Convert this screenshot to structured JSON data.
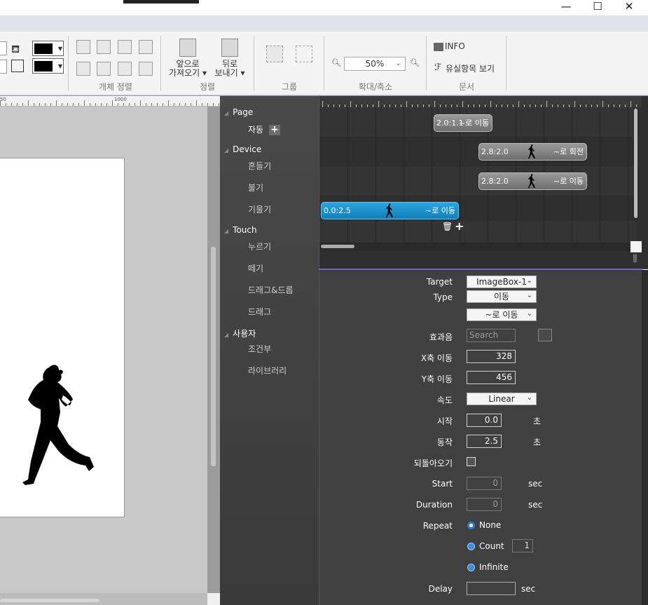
{
  "window": {
    "minimize": "—",
    "maximize": "☐",
    "close": "✕"
  },
  "ribbon": {
    "align_group_label": "개체 정렬",
    "order_group": {
      "label": "정렬",
      "bring_forward": [
        "앞으로",
        "가져오기 ▾"
      ],
      "send_backward": [
        "뒤로",
        "보내기 ▾"
      ]
    },
    "group_label": "그룹",
    "zoom": {
      "label": "확대/축소",
      "value": "50%"
    },
    "doc": {
      "label": "문서",
      "info": "INFO",
      "check": "유실항목 보기"
    }
  },
  "ruler": {
    "marks": [
      "50",
      "1000"
    ]
  },
  "tree": {
    "groups": [
      {
        "label": "Page",
        "items": [
          "자동"
        ]
      },
      {
        "label": "Device",
        "items": [
          "흔들기",
          "불기",
          "기울기"
        ]
      },
      {
        "label": "Touch",
        "items": [
          "누르기",
          "떼기",
          "드래그&드롭",
          "드래그"
        ]
      },
      {
        "label": "사용자",
        "items": [
          "조건부",
          "라이브러리"
        ]
      }
    ]
  },
  "timeline": {
    "blocks": [
      {
        "time": "2.0:1.1",
        "label": "~로 이동",
        "selected": false
      },
      {
        "time": "2.8:2.0",
        "label": "~로 회전",
        "selected": false
      },
      {
        "time": "2.8:2.0",
        "label": "~로 이동",
        "selected": false
      },
      {
        "time": "0.0:2.5",
        "label": "~로 이동",
        "selected": true
      }
    ]
  },
  "props": {
    "target": {
      "label": "Target",
      "value": "ImageBox-1"
    },
    "type": {
      "label": "Type",
      "value": "이동",
      "sub": "~로 이동"
    },
    "sound": {
      "label": "효과음",
      "placeholder": "Search"
    },
    "x": {
      "label": "X축 이동",
      "value": "328"
    },
    "y": {
      "label": "Y축 이동",
      "value": "456"
    },
    "speed": {
      "label": "속도",
      "value": "Linear"
    },
    "begin": {
      "label": "시작",
      "value": "0.0",
      "unit": "초"
    },
    "action": {
      "label": "동작",
      "value": "2.5",
      "unit": "초"
    },
    "reverse": {
      "label": "되돌아오기",
      "checked": false
    },
    "start": {
      "label": "Start",
      "value": "0",
      "unit": "sec"
    },
    "duration": {
      "label": "Duration",
      "value": "0",
      "unit": "sec"
    },
    "repeat": {
      "label": "Repeat",
      "options": [
        "None",
        "Count",
        "Infinite"
      ],
      "selected": "None",
      "count": "1"
    },
    "delay": {
      "label": "Delay",
      "value": "",
      "unit": "sec"
    }
  },
  "colors": {
    "accent": "#2f7ad9",
    "selected_block": "#1f93cf",
    "panel_dark": "#404040",
    "menu_strip": "#dfe3ec"
  }
}
